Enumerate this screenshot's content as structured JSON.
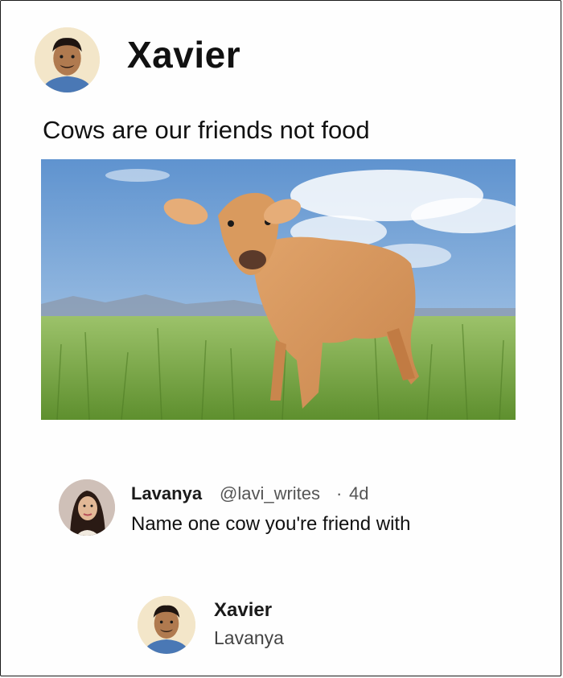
{
  "post": {
    "author": "Xavier",
    "text": "Cows are our friends not food",
    "image_subject": "calf-standing-in-grass-field"
  },
  "reply": {
    "name": "Lavanya",
    "handle": "@lavi_writes",
    "separator": "·",
    "time": "4d",
    "text": "Name one cow you're friend with"
  },
  "response": {
    "name": "Xavier",
    "text": "Lavanya"
  },
  "colors": {
    "sky": "#7fa8d8",
    "grass": "#7fa84a",
    "calf": "#d99a5e",
    "border": "#1a1a1a"
  }
}
